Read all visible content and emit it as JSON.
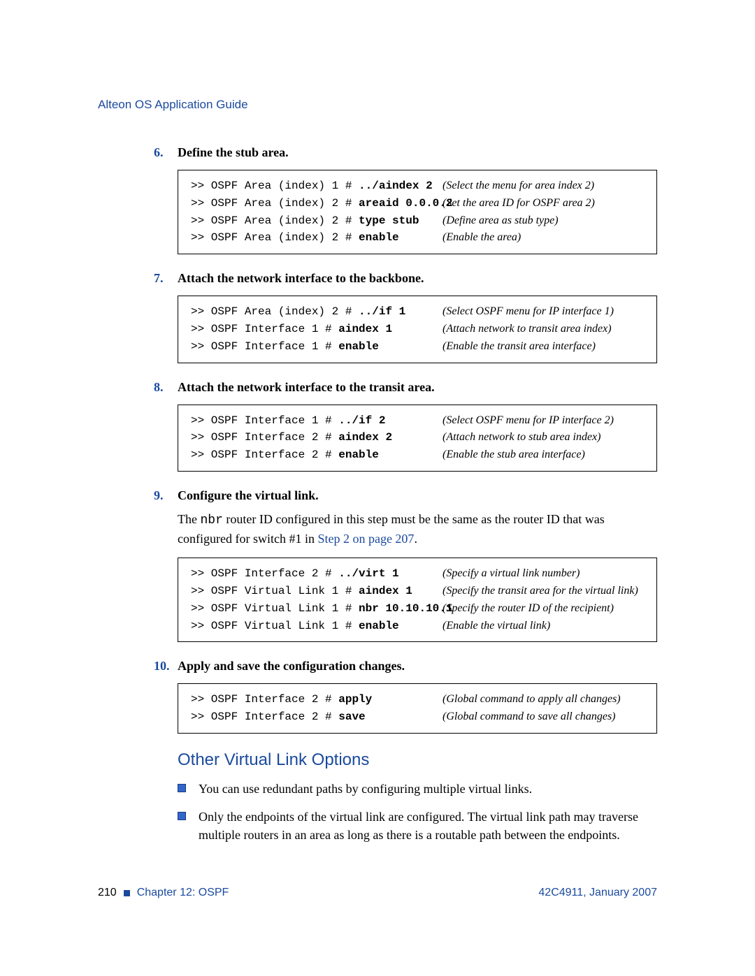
{
  "header": "Alteon OS Application Guide",
  "steps": {
    "s6": {
      "num": "6.",
      "title": "Define the stub area."
    },
    "s7": {
      "num": "7.",
      "title": "Attach the network interface to the backbone."
    },
    "s8": {
      "num": "8.",
      "title": "Attach the network interface to the transit area."
    },
    "s9": {
      "num": "9.",
      "title": "Configure the virtual link."
    },
    "s10": {
      "num": "10.",
      "title": "Apply and save the configuration changes."
    }
  },
  "box6": [
    {
      "pre": ">> OSPF Area (index) 1 # ",
      "cmd": "../aindex 2",
      "note": "(Select the menu for area index 2)"
    },
    {
      "pre": ">> OSPF Area (index) 2 # ",
      "cmd": "areaid 0.0.0.2",
      "note": "(Set the area ID for OSPF area 2)"
    },
    {
      "pre": ">> OSPF Area (index) 2 # ",
      "cmd": "type stub",
      "note": "(Define area as stub type)"
    },
    {
      "pre": ">> OSPF Area (index) 2 # ",
      "cmd": "enable",
      "note": "(Enable the area)"
    }
  ],
  "box7": [
    {
      "pre": ">> OSPF Area (index) 2 # ",
      "cmd": "../if 1",
      "note": "(Select OSPF menu for IP interface 1)"
    },
    {
      "pre": ">> OSPF Interface 1 # ",
      "cmd": "aindex 1",
      "note": "(Attach network to transit area index)"
    },
    {
      "pre": ">> OSPF Interface 1 # ",
      "cmd": "enable",
      "note": "(Enable the transit area interface)"
    }
  ],
  "box8": [
    {
      "pre": ">> OSPF Interface 1 # ",
      "cmd": "../if 2",
      "note": "(Select OSPF menu for IP interface 2)"
    },
    {
      "pre": ">> OSPF Interface 2 # ",
      "cmd": "aindex 2",
      "note": "(Attach network to stub area index)"
    },
    {
      "pre": ">> OSPF Interface 2 # ",
      "cmd": "enable",
      "note": "(Enable the stub area interface)"
    }
  ],
  "para9": {
    "t1": "The ",
    "code": "nbr",
    "t2": " router ID configured in this step must be the same as the router ID that was configured for switch #1 in ",
    "link": "Step 2 on page 207",
    "t3": "."
  },
  "box9": [
    {
      "pre": ">> OSPF Interface 2 # ",
      "cmd": "../virt 1",
      "note": "(Specify a virtual link number)"
    },
    {
      "pre": ">> OSPF Virtual Link 1 # ",
      "cmd": "aindex 1",
      "note": "(Specify the transit area for the virtual link)"
    },
    {
      "pre": ">> OSPF Virtual Link 1 # ",
      "cmd": "nbr 10.10.10.1",
      "note": "(Specify the router ID of the recipient)"
    },
    {
      "pre": ">> OSPF Virtual Link 1 # ",
      "cmd": "enable",
      "note": "(Enable the virtual link)"
    }
  ],
  "box10": [
    {
      "pre": ">> OSPF Interface 2 # ",
      "cmd": "apply",
      "note": "(Global command to apply all changes)"
    },
    {
      "pre": ">> OSPF Interface 2 # ",
      "cmd": "save",
      "note": "(Global command to save all changes)"
    }
  ],
  "subsection": "Other Virtual Link Options",
  "bullets": [
    "You can use redundant paths by configuring multiple virtual links.",
    "Only the endpoints of the virtual link are configured. The virtual link path may traverse multiple routers in an area as long as there is a routable path between the endpoints."
  ],
  "footer": {
    "page": "210",
    "chapter": "Chapter 12:  OSPF",
    "doc": "42C4911, January 2007"
  }
}
